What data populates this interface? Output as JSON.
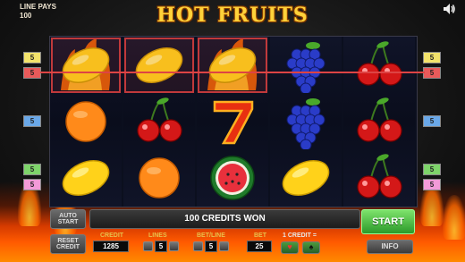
{
  "header": {
    "line_pays_label": "LINE PAYS",
    "line_pays_value": "100",
    "logo": "HOT FRUITS"
  },
  "left_badges": [
    {
      "label": "5",
      "color": "#f3e36b"
    },
    {
      "label": "5",
      "color": "#e85a5a"
    },
    {
      "label": "5",
      "color": "#6aa8e8"
    },
    {
      "label": "5",
      "color": "#7ed46a"
    },
    {
      "label": "5",
      "color": "#f39ad8"
    }
  ],
  "right_badges": [
    {
      "label": "5",
      "color": "#f3e36b"
    },
    {
      "label": "5",
      "color": "#e85a5a"
    },
    {
      "label": "5",
      "color": "#6aa8e8"
    },
    {
      "label": "5",
      "color": "#7ed46a"
    },
    {
      "label": "5",
      "color": "#f39ad8"
    }
  ],
  "reels": [
    [
      "lemon-burning",
      "orange",
      "lemon"
    ],
    [
      "lemon",
      "cherries",
      "orange"
    ],
    [
      "lemon-burning",
      "seven",
      "watermelon"
    ],
    [
      "grapes",
      "grapes",
      "lemon"
    ],
    [
      "cherries",
      "cherries",
      "cherries"
    ]
  ],
  "winning_cells": [
    [
      0,
      0
    ],
    [
      1,
      0
    ],
    [
      2,
      0
    ]
  ],
  "controls": {
    "auto_start": "AUTO START",
    "reset_credit": "RESET CREDIT",
    "message": "100 CREDITS WON",
    "start": "START",
    "credit_label": "CREDIT",
    "credit_value": "1285",
    "lines_label": "LINES",
    "lines_value": "5",
    "bet_line_label": "BET/LINE",
    "bet_line_value": "5",
    "bet_label": "BET",
    "bet_value": "25",
    "credit_rate_label": "1 CREDIT =",
    "info": "INFO"
  },
  "colors": {
    "accent_gold": "#ffd23a",
    "win_frame": "#c0393b",
    "start_green": "#4cc23e"
  }
}
